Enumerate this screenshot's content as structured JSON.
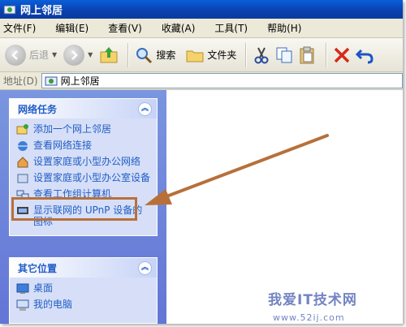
{
  "window": {
    "title": "网上邻居"
  },
  "menubar": {
    "items": [
      "文件(F)",
      "编辑(E)",
      "查看(V)",
      "收藏(A)",
      "工具(T)",
      "帮助(H)"
    ]
  },
  "toolbar": {
    "back_label": "后退",
    "search_label": "搜索",
    "folders_label": "文件夹"
  },
  "address": {
    "label": "地址(D)",
    "value": "网上邻居"
  },
  "network_tasks": {
    "title": "网络任务",
    "items": [
      "添加一个网上邻居",
      "查看网络连接",
      "设置家庭或小型办公网络",
      "设置家庭或小型办公室设备",
      "查看工作组计算机",
      "显示联网的 UPnP 设备的图标"
    ]
  },
  "other_places": {
    "title": "其它位置",
    "items": [
      "桌面",
      "我的电脑"
    ]
  },
  "watermark": {
    "text": "我爱IT技术网",
    "url": "www.52ij.com"
  },
  "colors": {
    "titlebar": "#0a3fae",
    "sidebar": "#6375d6",
    "panel_link": "#215dc6",
    "highlight": "#b7703a"
  }
}
